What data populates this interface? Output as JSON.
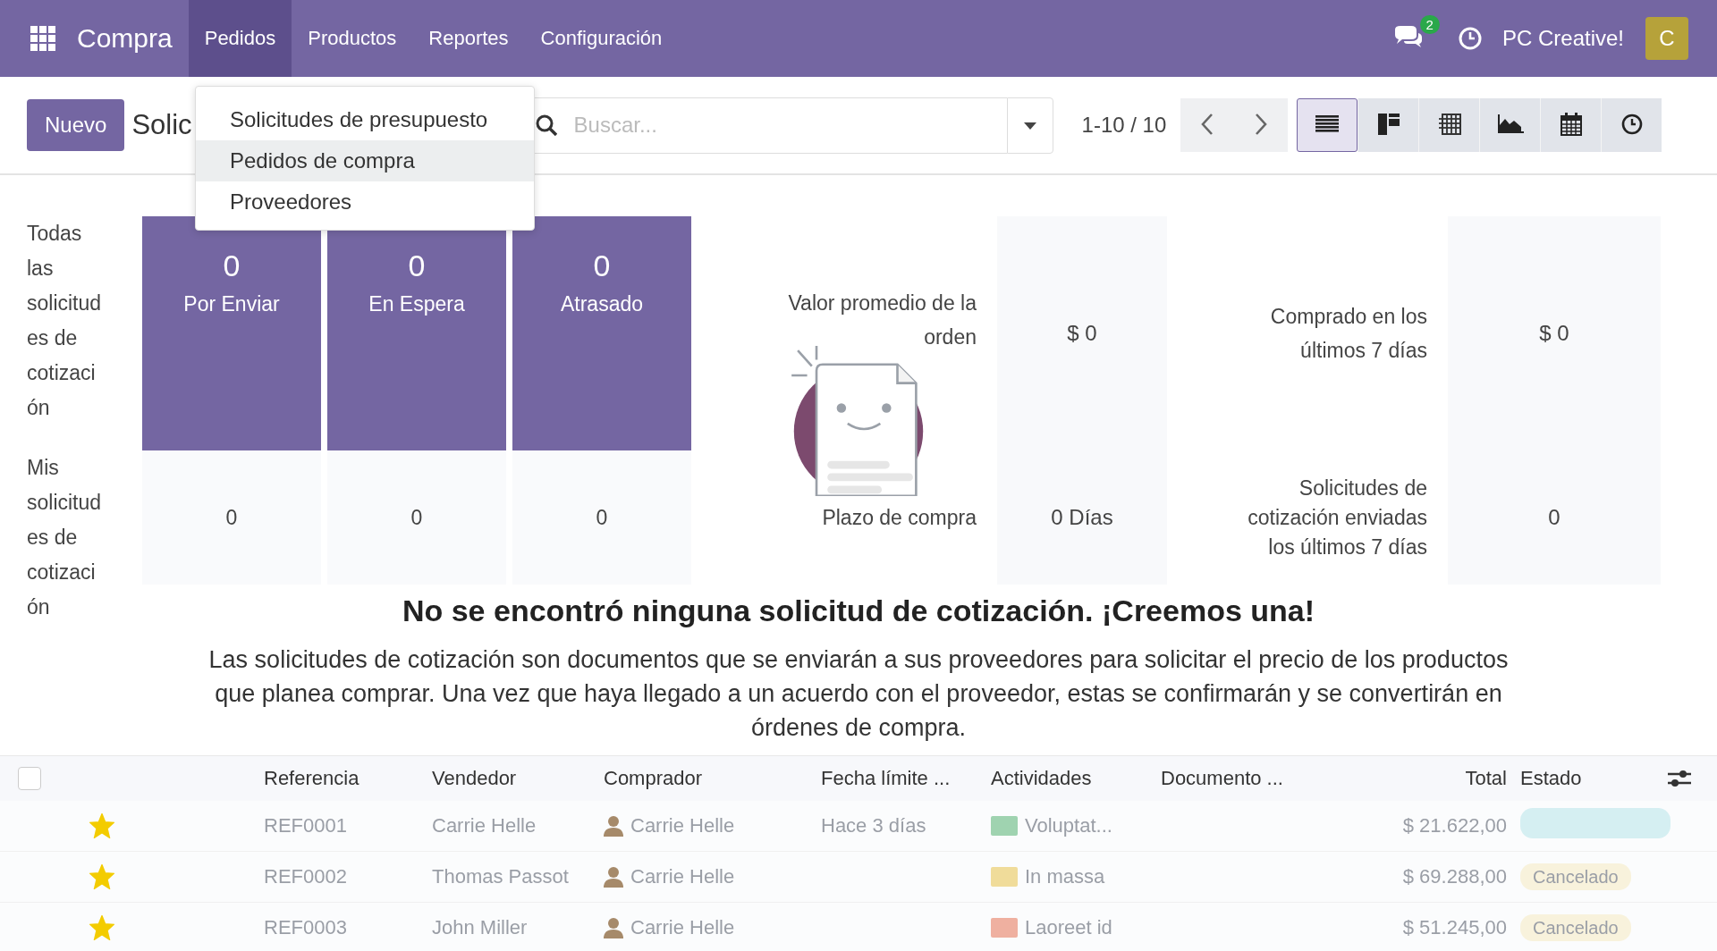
{
  "navbar": {
    "app_name": "Compra",
    "menus": [
      {
        "label": "Pedidos",
        "selected": true
      },
      {
        "label": "Productos",
        "selected": false
      },
      {
        "label": "Reportes",
        "selected": false
      },
      {
        "label": "Configuración",
        "selected": false
      }
    ],
    "messages_badge": "2",
    "company": "PC Creative!",
    "avatar_letter": "C"
  },
  "dropdown": {
    "items": [
      {
        "label": "Solicitudes de presupuesto",
        "selected": false
      },
      {
        "label": "Pedidos de compra",
        "selected": true
      },
      {
        "label": "Proveedores",
        "selected": false
      }
    ]
  },
  "control_panel": {
    "new_button": "Nuevo",
    "title": "Solic",
    "search": {
      "placeholder": "Buscar..."
    },
    "pager": "1-10 / 10",
    "views": [
      {
        "kind": "list",
        "selected": true
      },
      {
        "kind": "kanban",
        "selected": false
      },
      {
        "kind": "pivot",
        "selected": false
      },
      {
        "kind": "graph",
        "selected": false
      },
      {
        "kind": "calendar",
        "selected": false
      },
      {
        "kind": "activity",
        "selected": false
      }
    ]
  },
  "dashboard": {
    "rows": [
      {
        "label": "Todas las solicitudes de cotización",
        "highlighted": true,
        "tiles": [
          {
            "value": "0",
            "label": "Por Enviar"
          },
          {
            "value": "0",
            "label": "En Espera"
          },
          {
            "value": "0",
            "label": "Atrasado"
          }
        ],
        "stats": [
          {
            "label": "Valor promedio de la orden",
            "value": "$ 0"
          },
          {
            "label": "Comprado en los últimos 7 días",
            "value": "$ 0"
          }
        ]
      },
      {
        "label": "Mis solicitudes de cotización",
        "highlighted": false,
        "tiles": [
          {
            "value": "0"
          },
          {
            "value": "0"
          },
          {
            "value": "0"
          }
        ],
        "stats": [
          {
            "label": "Plazo de compra",
            "value": "0 Días"
          },
          {
            "label": "Solicitudes de cotización enviadas los últimos 7 días",
            "value": "0"
          }
        ]
      }
    ]
  },
  "empty_state": {
    "title": "No se encontró ninguna solicitud de cotización. ¡Creemos una!",
    "text": "Las solicitudes de cotización son documentos que se enviarán a sus proveedores para solicitar el precio de los productos que planea comprar. Una vez que haya llegado a un acuerdo con el proveedor, estas se confirmarán y se convertirán en órdenes de compra."
  },
  "table": {
    "select_all": {
      "checked": false
    },
    "columns": [
      "Referencia",
      "Vendedor",
      "Comprador",
      "Fecha límite ...",
      "Actividades",
      "Documento ...",
      "Total",
      "Estado"
    ],
    "rows": [
      {
        "starred": true,
        "reference": "REF0001",
        "vendor": "Carrie Helle",
        "buyer": "Carrie Helle",
        "deadline": "Hace 3 días",
        "activity": {
          "label": "Voluptat...",
          "color": "#9fd3b0"
        },
        "total": "$ 21.622,00",
        "status": {
          "color": "#d5eff2"
        }
      },
      {
        "starred": true,
        "reference": "REF0002",
        "vendor": "Thomas Passot",
        "buyer": "Carrie Helle",
        "activity": {
          "label": "In massa",
          "color": "#f0dc9a"
        },
        "total": "$ 69.288,00",
        "status": {
          "label": "Cancelado",
          "color": "#f8f2dc"
        }
      },
      {
        "starred": true,
        "reference": "REF0003",
        "vendor": "John Miller",
        "buyer": "Carrie Helle",
        "activity": {
          "label": "Laoreet id",
          "color": "#efb0a0"
        },
        "total": "$ 51.245,00",
        "status": {
          "label": "Cancelado",
          "color": "#f8f2dc"
        }
      }
    ]
  }
}
